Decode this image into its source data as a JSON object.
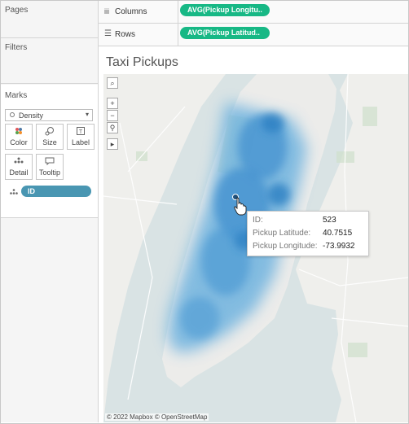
{
  "cards": {
    "pages_title": "Pages",
    "filters_title": "Filters",
    "marks_title": "Marks"
  },
  "marks": {
    "mark_type": "Density",
    "buttons": {
      "color": "Color",
      "size": "Size",
      "label": "Label",
      "detail": "Detail",
      "tooltip": "Tooltip"
    },
    "field_pill": "ID"
  },
  "shelves": {
    "columns_label": "Columns",
    "columns_pill": "AVG(Pickup Longitu..",
    "rows_label": "Rows",
    "rows_pill": "AVG(Pickup Latitud.."
  },
  "viz": {
    "title": "Taxi Pickups",
    "attribution": "© 2022 Mapbox © OpenStreetMap"
  },
  "tooltip": {
    "rows": [
      {
        "key": "ID:",
        "value": "523"
      },
      {
        "key": "Pickup Latitude:",
        "value": "40.7515"
      },
      {
        "key": "Pickup Longitude:",
        "value": "-73.9932"
      }
    ]
  },
  "colors": {
    "pill_green": "#17b885",
    "pill_blue": "#4996b2",
    "water": "#d9e3e4",
    "land": "#efefec",
    "density": "#2a7fc2"
  },
  "icons": {
    "columns": "columns-icon",
    "rows": "rows-icon",
    "search": "search-icon",
    "zoom_in": "zoom-in-icon",
    "zoom_out": "zoom-out-icon",
    "pin": "pin-icon",
    "expand": "expand-icon"
  }
}
